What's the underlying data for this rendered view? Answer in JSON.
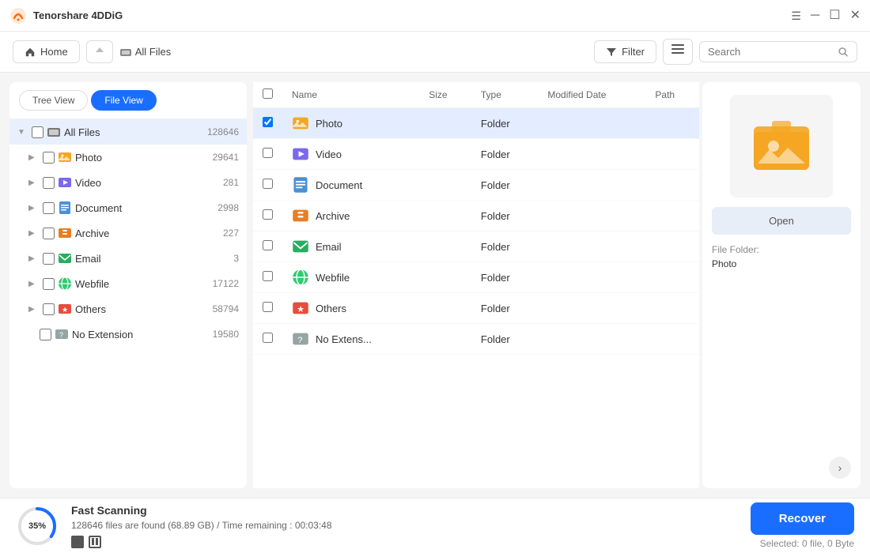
{
  "app": {
    "title": "Tenorshare 4DDiG",
    "logo_color": "#f5a623"
  },
  "titlebar": {
    "menu_icon": "☰",
    "minimize_icon": "─",
    "maximize_icon": "☐",
    "close_icon": "✕"
  },
  "navbar": {
    "home_label": "Home",
    "up_icon": "↑",
    "breadcrumb": "All Files",
    "filter_label": "Filter",
    "list_icon": "☰",
    "search_placeholder": "Search"
  },
  "sidebar": {
    "tree_view_label": "Tree View",
    "file_view_label": "File View",
    "items": [
      {
        "id": "all-files",
        "label": "All Files",
        "count": "128646",
        "indent": 0,
        "hasArrow": true,
        "expanded": true,
        "icon": "drive",
        "selected": true
      },
      {
        "id": "photo",
        "label": "Photo",
        "count": "29641",
        "indent": 1,
        "hasArrow": true,
        "icon": "photo"
      },
      {
        "id": "video",
        "label": "Video",
        "count": "281",
        "indent": 1,
        "hasArrow": true,
        "icon": "video"
      },
      {
        "id": "document",
        "label": "Document",
        "count": "2998",
        "indent": 1,
        "hasArrow": true,
        "icon": "doc"
      },
      {
        "id": "archive",
        "label": "Archive",
        "count": "227",
        "indent": 1,
        "hasArrow": true,
        "icon": "archive"
      },
      {
        "id": "email",
        "label": "Email",
        "count": "3",
        "indent": 1,
        "hasArrow": true,
        "icon": "email"
      },
      {
        "id": "webfile",
        "label": "Webfile",
        "count": "17122",
        "indent": 1,
        "hasArrow": true,
        "icon": "web"
      },
      {
        "id": "others",
        "label": "Others",
        "count": "58794",
        "indent": 1,
        "hasArrow": true,
        "icon": "others"
      },
      {
        "id": "noext",
        "label": "No Extension",
        "count": "19580",
        "indent": 1,
        "hasArrow": false,
        "icon": "noext"
      }
    ]
  },
  "file_list": {
    "columns": [
      "Name",
      "Size",
      "Type",
      "Modified Date",
      "Path"
    ],
    "rows": [
      {
        "id": "photo",
        "name": "Photo",
        "size": "",
        "type": "Folder",
        "modified": "",
        "path": "",
        "icon": "photo",
        "selected": true
      },
      {
        "id": "video",
        "name": "Video",
        "size": "",
        "type": "Folder",
        "modified": "",
        "path": "",
        "icon": "video"
      },
      {
        "id": "document",
        "name": "Document",
        "size": "",
        "type": "Folder",
        "modified": "",
        "path": "",
        "icon": "doc"
      },
      {
        "id": "archive",
        "name": "Archive",
        "size": "",
        "type": "Folder",
        "modified": "",
        "path": "",
        "icon": "archive"
      },
      {
        "id": "email",
        "name": "Email",
        "size": "",
        "type": "Folder",
        "modified": "",
        "path": "",
        "icon": "email"
      },
      {
        "id": "webfile",
        "name": "Webfile",
        "size": "",
        "type": "Folder",
        "modified": "",
        "path": "",
        "icon": "web"
      },
      {
        "id": "others",
        "name": "Others",
        "size": "",
        "type": "Folder",
        "modified": "",
        "path": "",
        "icon": "others"
      },
      {
        "id": "noext",
        "name": "No Extens...",
        "size": "",
        "type": "Folder",
        "modified": "",
        "path": "",
        "icon": "noext"
      }
    ]
  },
  "preview": {
    "open_label": "Open",
    "file_folder_label": "File Folder:",
    "file_folder_value": "Photo",
    "nav_next": "›"
  },
  "bottom_bar": {
    "progress_pct": 35,
    "progress_label": "35%",
    "scan_title": "Fast Scanning",
    "scan_subtitle": "128646 files are found (68.89 GB)  /  Time remaining : 00:03:48",
    "recover_label": "Recover",
    "selected_info": "Selected: 0 file, 0 Byte"
  }
}
